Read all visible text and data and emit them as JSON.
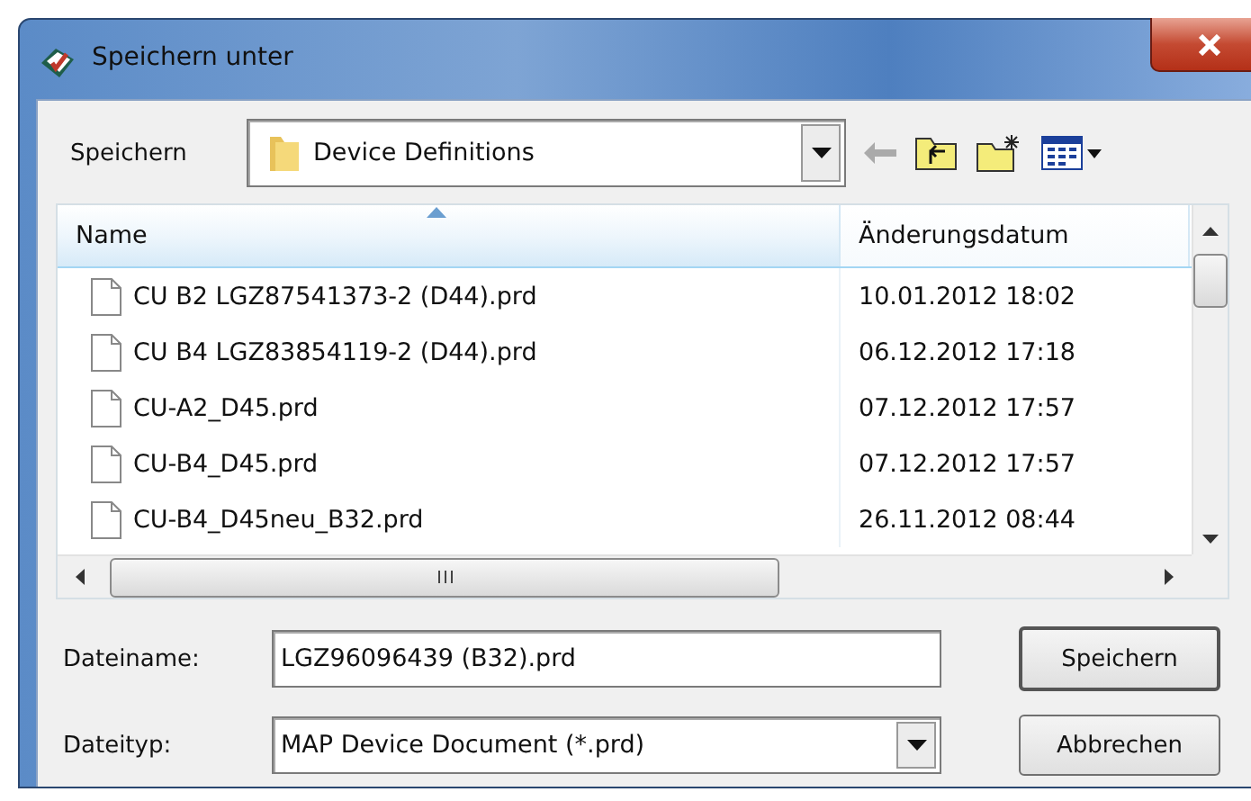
{
  "window": {
    "title": "Speichern unter"
  },
  "location": {
    "label": "Speichern",
    "value": "Device Definitions"
  },
  "file_list": {
    "columns": [
      {
        "label": "Name",
        "sorted": true
      },
      {
        "label": "Änderungsdatum",
        "sorted": false
      }
    ],
    "rows": [
      {
        "name": "CU B2 LGZ87541373-2 (D44).prd",
        "date": "10.01.2012 18:02"
      },
      {
        "name": "CU B4 LGZ83854119-2 (D44).prd",
        "date": "06.12.2012 17:18"
      },
      {
        "name": "CU-A2_D45.prd",
        "date": "07.12.2012 17:57"
      },
      {
        "name": "CU-B4_D45.prd",
        "date": "07.12.2012 17:57"
      },
      {
        "name": "CU-B4_D45neu_B32.prd",
        "date": "26.11.2012 08:44"
      }
    ]
  },
  "file_name": {
    "label": "Dateiname:",
    "value": "LGZ96096439 (B32).prd"
  },
  "file_type": {
    "label": "Dateityp:",
    "value": "MAP Device Document (*.prd)"
  },
  "buttons": [
    {
      "label": "Speichern",
      "default": true
    },
    {
      "label": "Abbrechen",
      "default": false
    }
  ]
}
